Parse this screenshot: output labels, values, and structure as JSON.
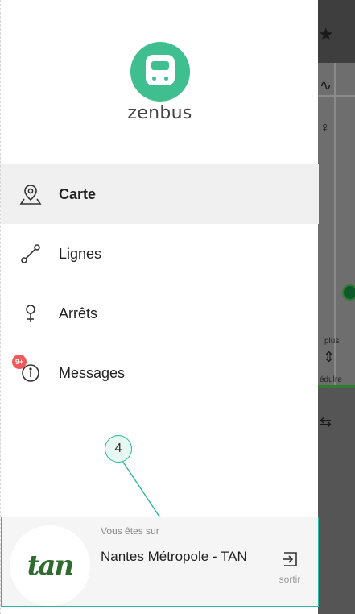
{
  "app": {
    "logo_text": "zenbus"
  },
  "menu": {
    "items": [
      {
        "id": "carte",
        "label": "Carte",
        "icon": "map-pin-icon",
        "active": true
      },
      {
        "id": "lignes",
        "label": "Lignes",
        "icon": "route-icon",
        "active": false
      },
      {
        "id": "arrets",
        "label": "Arrêts",
        "icon": "stop-pin-icon",
        "active": false
      },
      {
        "id": "messages",
        "label": "Messages",
        "icon": "info-icon",
        "active": false,
        "badge": "9+"
      }
    ]
  },
  "annotation": {
    "marker": "4"
  },
  "network": {
    "caption": "Vous êtes sur",
    "name": "Nantes Métropole - TAN",
    "logo_text": "tan",
    "exit_label": "sortir"
  },
  "backdrop": {
    "partial_labels": [
      "plus",
      "édulre"
    ]
  },
  "colors": {
    "brand": "#3fbf8f",
    "accent": "#2ab7a2",
    "badge": "#f15a5a",
    "tan_green": "#2e6b2e"
  }
}
